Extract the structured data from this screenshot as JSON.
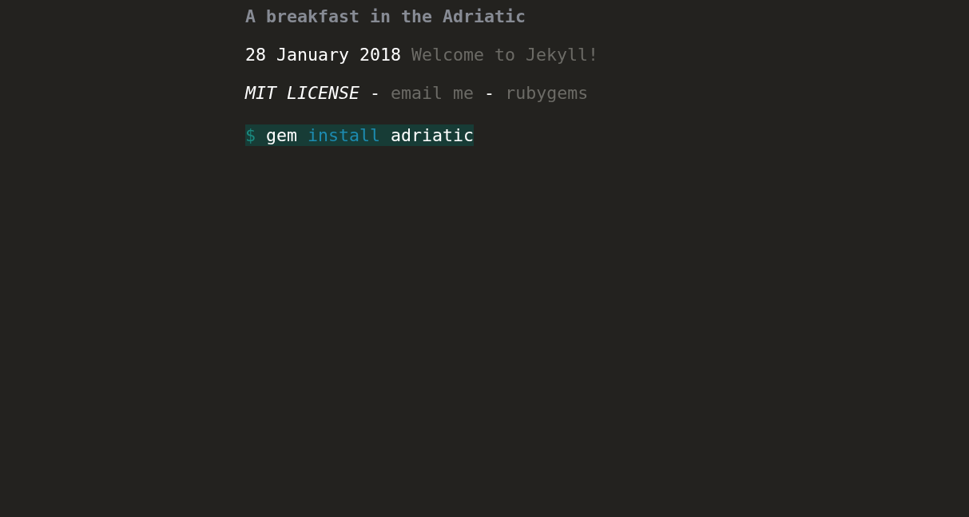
{
  "post_title": "A breakfast in the Adriatic",
  "post_meta": {
    "date": "28 January 2018",
    "post_link": "Welcome to Jekyll!"
  },
  "footer": {
    "license": "MIT LICENSE",
    "separator": "-",
    "links": [
      "email me",
      "rubygems"
    ]
  },
  "install_command": [
    {
      "text": "$",
      "kind": "prompt"
    },
    {
      "text": "gem",
      "kind": "command"
    },
    {
      "text": "install",
      "kind": "keyword"
    },
    {
      "text": "adriatic",
      "kind": "argument"
    }
  ]
}
